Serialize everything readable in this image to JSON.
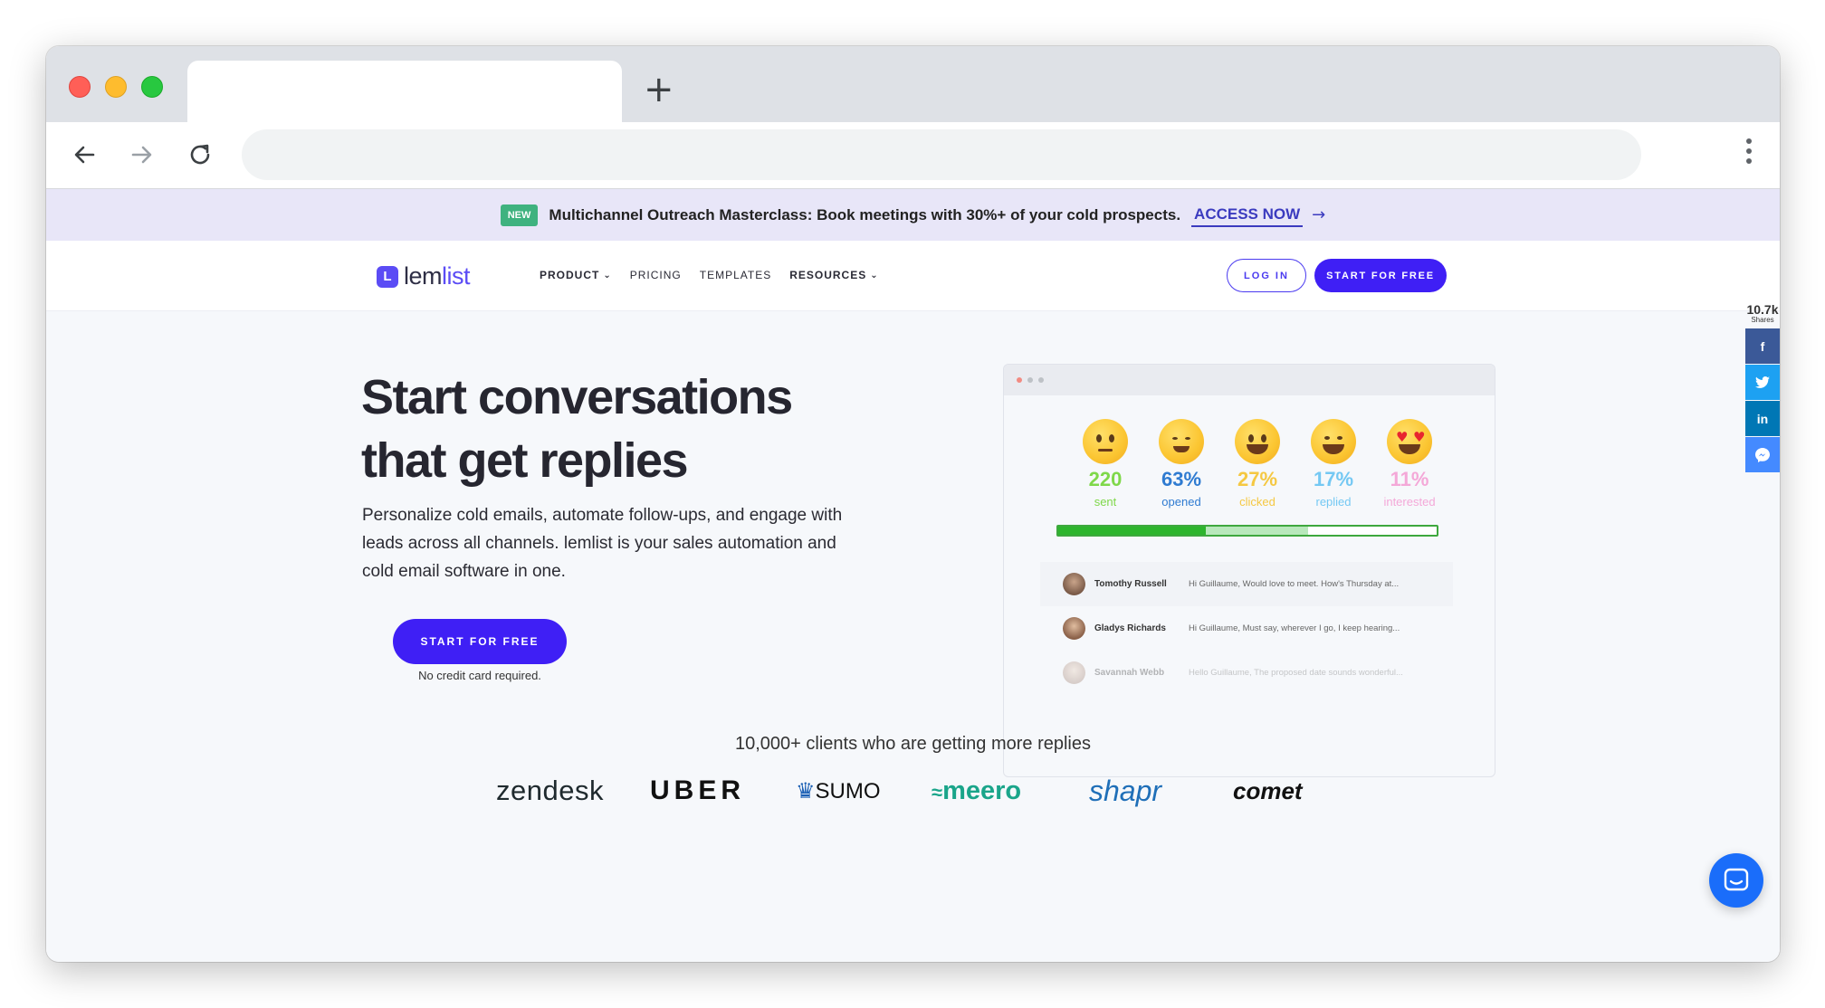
{
  "announcement": {
    "badge": "NEW",
    "text": "Multichannel Outreach Masterclass: Book meetings with 30%+ of your cold prospects.",
    "link": "ACCESS NOW",
    "arrow": "→"
  },
  "header": {
    "logo_mark": "L",
    "logo_light": "lem",
    "logo_bold": "list",
    "nav": [
      {
        "label": "PRODUCT"
      },
      {
        "label": "PRICING"
      },
      {
        "label": "TEMPLATES"
      },
      {
        "label": "RESOURCES"
      }
    ],
    "login": "LOG IN",
    "start": "START FOR FREE"
  },
  "hero": {
    "title_line1": "Start conversations",
    "title_line2": "that get replies",
    "description": "Personalize cold emails, automate follow-ups, and engage with leads across all channels. lemlist is your sales automation and cold email software in one.",
    "cta": "START FOR FREE",
    "note": "No credit card required."
  },
  "mockup": {
    "stats": [
      {
        "value": "220",
        "label": "sent",
        "color": "#7fd84a",
        "emoji": "thinking"
      },
      {
        "value": "63%",
        "label": "opened",
        "color": "#2f7bd1",
        "emoji": "smiling"
      },
      {
        "value": "27%",
        "label": "clicked",
        "color": "#f5c842",
        "emoji": "grinning"
      },
      {
        "value": "17%",
        "label": "replied",
        "color": "#74c8f3",
        "emoji": "beaming"
      },
      {
        "value": "11%",
        "label": "interested",
        "color": "#f4a8d8",
        "emoji": "heart-eyes"
      }
    ],
    "progress": {
      "primary": 0.39,
      "secondary": 0.27
    },
    "replies": [
      {
        "name": "Tomothy Russell",
        "message": "Hi Guillaume, Would love to meet. How's Thursday at..."
      },
      {
        "name": "Gladys Richards",
        "message": "Hi Guillaume, Must say, wherever I go, I keep hearing..."
      },
      {
        "name": "Savannah Webb",
        "message": "Hello Guillaume, The proposed date sounds wonderful..."
      }
    ]
  },
  "clients": {
    "text": "10,000+ clients who are getting more replies",
    "logos": [
      "zendesk",
      "UBER",
      "SUMO",
      "meero",
      "shapr",
      "comet"
    ]
  },
  "share": {
    "count": "10.7k",
    "label": "Shares",
    "buttons": [
      {
        "icon": "facebook-icon",
        "glyph": "f",
        "color": "#3b5998"
      },
      {
        "icon": "twitter-icon",
        "glyph": "t",
        "color": "#1da1f2"
      },
      {
        "icon": "linkedin-icon",
        "glyph": "in",
        "color": "#0077b5"
      },
      {
        "icon": "messenger-icon",
        "glyph": "m",
        "color": "#448aff"
      }
    ]
  }
}
